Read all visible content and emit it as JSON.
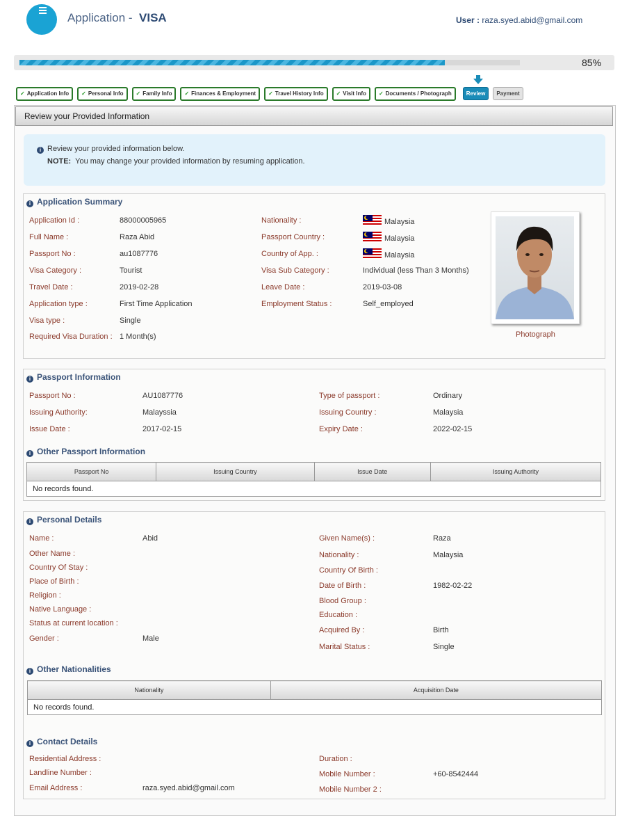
{
  "header": {
    "title_prefix": "Application -",
    "title_strong": "VISA",
    "user_label": "User :",
    "user_email": "raza.syed.abid@gmail.com"
  },
  "progress": {
    "percent_label": "85%",
    "value": 0.85
  },
  "steps": [
    {
      "label": "Application Info",
      "state": "done"
    },
    {
      "label": "Personal Info",
      "state": "done"
    },
    {
      "label": "Family Info",
      "state": "done"
    },
    {
      "label": "Finances & Employment",
      "state": "done"
    },
    {
      "label": "Travel History Info",
      "state": "done"
    },
    {
      "label": "Visit Info",
      "state": "done"
    },
    {
      "label": "Documents / Photograph",
      "state": "done"
    },
    {
      "label": "Review",
      "state": "current"
    },
    {
      "label": "Payment",
      "state": "pending"
    }
  ],
  "check_glyph": "✓",
  "panel": {
    "title": "Review your Provided Information"
  },
  "notice": {
    "line1": "Review your provided information below.",
    "note_label": "NOTE:",
    "note_text": "You may change your provided information by resuming application."
  },
  "summary": {
    "title": "Application Summary",
    "left": [
      {
        "label": "Application Id :",
        "value": "88000005965"
      },
      {
        "label": "Full Name :",
        "value": "Raza Abid"
      },
      {
        "label": "Passport No :",
        "value": "au1087776"
      },
      {
        "label": "Visa Category :",
        "value": "Tourist"
      },
      {
        "label": "Travel Date :",
        "value": "2019-02-28"
      },
      {
        "label": "Application type :",
        "value": "First Time Application"
      },
      {
        "label": "Visa type :",
        "value": "Single"
      },
      {
        "label": "Required Visa Duration :",
        "value": "1 Month(s)"
      }
    ],
    "right": [
      {
        "label": "Nationality :",
        "value": "Malaysia"
      },
      {
        "label": "Passport Country :",
        "value": "Malaysia"
      },
      {
        "label": "Country of App. :",
        "value": "Malaysia"
      },
      {
        "label": "Visa Sub Category :",
        "value": "Individual (less Than 3 Months)"
      },
      {
        "label": "Leave Date :",
        "value": "2019-03-08"
      },
      {
        "label": "Employment Status :",
        "value": "Self_employed"
      }
    ],
    "photo_caption": "Photograph"
  },
  "passport": {
    "title": "Passport Information",
    "left": [
      {
        "label": "Passport No :",
        "value": "AU1087776"
      },
      {
        "label": "Issuing Authority:",
        "value": "Malayssia"
      },
      {
        "label": "Issue Date :",
        "value": "2017-02-15"
      }
    ],
    "right": [
      {
        "label": "Type of passport :",
        "value": "Ordinary"
      },
      {
        "label": "Issuing Country :",
        "value": "Malaysia"
      },
      {
        "label": "Expiry Date :",
        "value": "2022-02-15"
      }
    ],
    "other_title": "Other Passport Information",
    "other_columns": [
      "Passport No",
      "Issuing Country",
      "Issue Date",
      "Issuing Authority"
    ],
    "other_empty": "No records found."
  },
  "personal": {
    "title": "Personal Details",
    "left": [
      {
        "label": "Name :",
        "value": "Abid"
      },
      {
        "label": "Other Name :",
        "value": ""
      },
      {
        "label": "Country Of Stay :",
        "value": ""
      },
      {
        "label": "Place of Birth :",
        "value": ""
      },
      {
        "label": "Religion :",
        "value": ""
      },
      {
        "label": "Native Language :",
        "value": ""
      },
      {
        "label": "Status at current location :",
        "value": ""
      },
      {
        "label": "Gender :",
        "value": "Male"
      }
    ],
    "right": [
      {
        "label": "Given Name(s) :",
        "value": "Raza"
      },
      {
        "label": "Nationality :",
        "value": "Malaysia"
      },
      {
        "label": "Country Of Birth :",
        "value": ""
      },
      {
        "label": "Date of Birth :",
        "value": "1982-02-22"
      },
      {
        "label": "Blood Group :",
        "value": ""
      },
      {
        "label": "Education :",
        "value": ""
      },
      {
        "label": "Acquired By :",
        "value": "Birth"
      },
      {
        "label": "Marital Status :",
        "value": "Single"
      }
    ],
    "nat_title": "Other Nationalities",
    "nat_columns": [
      "Nationality",
      "Acquisition Date"
    ],
    "nat_empty": "No records found."
  },
  "contact": {
    "title": "Contact Details",
    "left": [
      {
        "label": "Residential Address :",
        "value": ""
      },
      {
        "label": "Landline Number :",
        "value": ""
      },
      {
        "label": "Email Address :",
        "value": "raza.syed.abid@gmail.com"
      }
    ],
    "right": [
      {
        "label": "Duration :",
        "value": ""
      },
      {
        "label": "Mobile Number :",
        "value": "+60-8542444"
      },
      {
        "label": "Mobile Number 2 :",
        "value": ""
      }
    ]
  },
  "colors": {
    "accent": "#1aa3d4",
    "label": "#8b3a2b",
    "title": "#3b5479",
    "done_border": "#2a7a2a"
  },
  "icons": {
    "info": "info-circle-icon",
    "menu": "menu-icon",
    "flag": "malaysia-flag-icon",
    "arrow": "down-arrow-icon"
  }
}
